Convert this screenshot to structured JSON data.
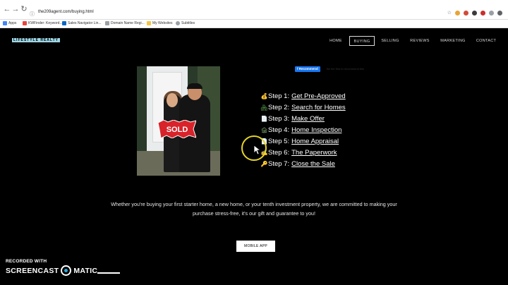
{
  "browser": {
    "url": "the209agent.com/buying.html",
    "bookmarks": [
      "Apps",
      "KWFinder: Keyword...",
      "Sales Navigator Lin...",
      "Domain Name Regi...",
      "My Websites",
      "Subtitles"
    ]
  },
  "site": {
    "logo": "LIFESTYLE REALTY",
    "nav": [
      "HOME",
      "BUYING",
      "SELLING",
      "REVIEWS",
      "MARKETING",
      "CONTACT"
    ],
    "active_nav": "BUYING",
    "photo_sign": "SOLD",
    "fb_button": "Recommend",
    "fb_text": "Be the first to recommend this",
    "steps": [
      {
        "label": "Step 1:",
        "link": "Get Pre-Approved",
        "icon": "money-bag-icon",
        "glyph": "💰",
        "color": "#e8b23a"
      },
      {
        "label": "Step 2:",
        "link": "Search for Homes",
        "icon": "house-icon",
        "glyph": "🏘",
        "color": "#5a9e4b"
      },
      {
        "label": "Step 3:",
        "link": "Make Offer ",
        "icon": "document-icon",
        "glyph": "📄",
        "color": "#e0e0e0"
      },
      {
        "label": "Step 4:",
        "link": "Home Inspection",
        "icon": "inspection-icon",
        "glyph": "🏚",
        "color": "#7aa36a"
      },
      {
        "label": "Step 5:",
        "link": "Home Appraisal",
        "icon": "appraisal-icon",
        "glyph": "📄",
        "color": "#e0e0e0"
      },
      {
        "label": "Step 6:",
        "link": "The Paperwork",
        "icon": "paperwork-icon",
        "glyph": "✍",
        "color": "#e8b23a"
      },
      {
        "label": "Step 7:",
        "link": "Close the Sale",
        "icon": "key-icon",
        "glyph": "🔑",
        "color": "#e8b23a"
      }
    ],
    "description": "Whether you're buying your first starter home, a new home, or your tenth investment property, we are committed to making your purchase stress-free, it's our gift and guarantee to you!",
    "mobile_app_button": "MOBILE APP"
  },
  "watermark": {
    "recorded": "RECORDED WITH",
    "brand_left": "SCREENCAST",
    "brand_right": "MATIC"
  },
  "colors": {
    "background": "#000000",
    "fb_blue": "#1877f2",
    "cursor_ring": "#e6d42a",
    "logo": "#9fd7e6"
  }
}
